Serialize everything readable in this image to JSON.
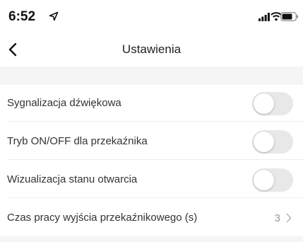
{
  "status_bar": {
    "time": "6:52",
    "icons": [
      "location-arrow-icon",
      "signal-icon",
      "wifi-icon",
      "battery-icon"
    ]
  },
  "nav": {
    "title": "Ustawienia",
    "back_icon": "chevron-left-icon"
  },
  "settings": [
    {
      "label": "Sygnalizacja dźwiękowa",
      "type": "toggle",
      "on": false
    },
    {
      "label": "Tryb ON/OFF dla przekaźnika",
      "type": "toggle",
      "on": false
    },
    {
      "label": "Wizualizacja stanu otwarcia",
      "type": "toggle",
      "on": false
    },
    {
      "label": "Czas pracy wyjścia przekaźnikowego (s)",
      "type": "value",
      "value": "3"
    }
  ],
  "colors": {
    "toggle_off": "#e8e8e8",
    "section_bg": "#f5f5f5",
    "value_text": "#9a9a9a"
  }
}
